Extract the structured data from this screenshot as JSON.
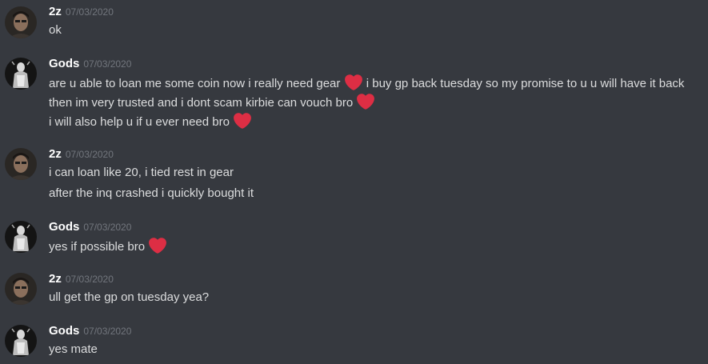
{
  "emojis": {
    "heart": {
      "icon": "red-heart-icon",
      "color": "#dd2e44"
    }
  },
  "users": {
    "z2": {
      "name": "2z",
      "avatar": "user-photo-avatar"
    },
    "gods": {
      "name": "Gods",
      "avatar": "statue-avatar"
    }
  },
  "messages": [
    {
      "author": "2z",
      "time": "07/03/2020",
      "lines": [
        "ok"
      ]
    },
    {
      "author": "Gods",
      "time": "07/03/2020",
      "lines": [
        "are u able to loan me some coin now i really need gear",
        "i buy gp back tuesday so my promise to u u will have it back then im very trusted and i dont scam kirbie can vouch bro",
        "i will also help u if u ever need bro"
      ]
    },
    {
      "author": "2z",
      "time": "07/03/2020",
      "lines": [
        "i can loan like 20, i tied rest in gear",
        "after the inq crashed i quickly bought it"
      ]
    },
    {
      "author": "Gods",
      "time": "07/03/2020",
      "lines": [
        "yes if possible bro"
      ]
    },
    {
      "author": "2z",
      "time": "07/03/2020",
      "lines": [
        "ull get the gp on tuesday yea?"
      ]
    },
    {
      "author": "Gods",
      "time": "07/03/2020",
      "lines": [
        "yes mate"
      ]
    }
  ]
}
